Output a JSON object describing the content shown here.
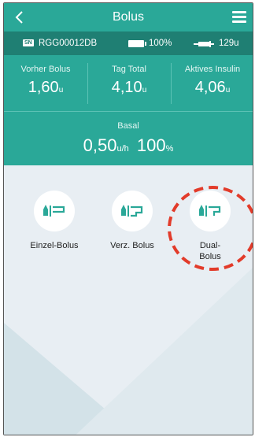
{
  "header": {
    "title": "Bolus",
    "back_icon": "chevron-left-icon",
    "menu_icon": "hamburger-menu-icon"
  },
  "status": {
    "sn_badge": "SN",
    "serial": "RGG00012DB",
    "battery": "100%",
    "insulin": "129u"
  },
  "stats": [
    {
      "label": "Vorher Bolus",
      "value": "1,60",
      "unit": "u"
    },
    {
      "label": "Tag Total",
      "value": "4,10",
      "unit": "u"
    },
    {
      "label": "Aktives Insulin",
      "value": "4,06",
      "unit": "u"
    }
  ],
  "basal": {
    "label": "Basal",
    "value": "0,50",
    "unit": "u/h",
    "percent": "100",
    "percent_unit": "%"
  },
  "bolus_options": [
    {
      "label": "Einzel-Bolus",
      "icon": "normal-bolus-icon"
    },
    {
      "label": "Verz. Bolus",
      "icon": "extended-bolus-icon"
    },
    {
      "label": "Dual-\nBolus",
      "icon": "dual-bolus-icon"
    }
  ],
  "colors": {
    "header": "#2aa898",
    "statusbar": "#1f7f73",
    "highlight": "#e23b2a"
  }
}
